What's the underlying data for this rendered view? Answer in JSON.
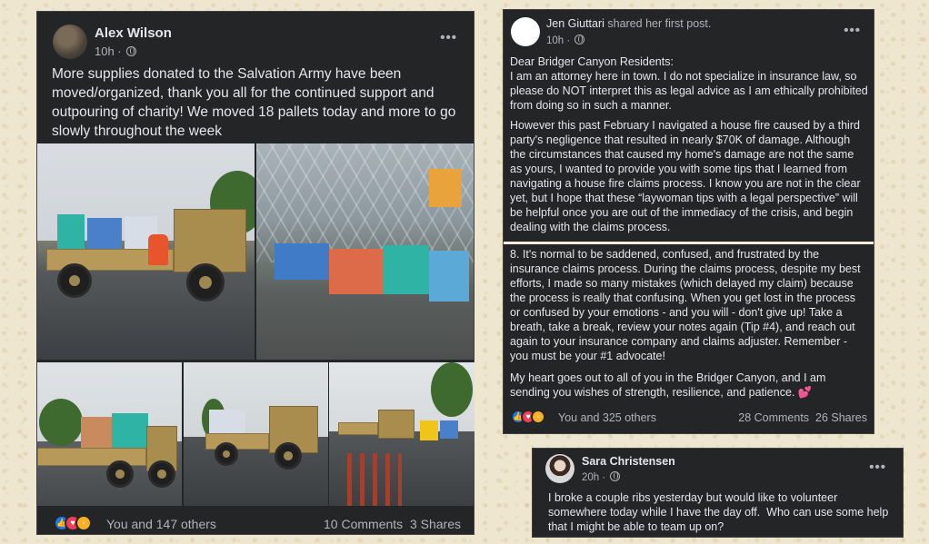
{
  "post1": {
    "author": "Alex Wilson",
    "time": "10h ·",
    "text": "More supplies donated to the Salvation Army have been moved/organized, thank you all for the continued support and outpouring of charity! We moved 18 pallets today and more to go slowly throughout the week",
    "reactions_text": "You and 147 others",
    "comments": "10 Comments",
    "shares": "3 Shares"
  },
  "post2": {
    "author": "Jen Giuttari",
    "action": "shared her first post.",
    "time": "10h ·",
    "paragraphs": [
      "Dear Bridger Canyon Residents:\nI am an attorney here in town. I do not specialize in insurance law, so please do NOT interpret this as legal advice as I am ethically prohibited from doing so in such a manner.",
      "However this past February I navigated a house fire caused by a third party's negligence that resulted in nearly $70K of damage. Although the circumstances that caused my home's damage are not the same as yours, I wanted to provide you with some tips that I learned from navigating a house fire claims process. I know you are not in the clear yet, but I hope that these “laywoman tips with a legal perspective” will be helpful once you are out of the immediacy of the crisis, and begin dealing with the claims process."
    ],
    "paragraphs2": [
      "8. It's normal to be saddened, confused, and frustrated by the insurance claims process. During the claims process, despite my best efforts, I made so many mistakes (which delayed my claim) because the process is really that confusing. When you get lost in the process or confused by your emotions - and you will - don't give up! Take a breath, take a break, review your notes again (Tip #4), and reach out again to your insurance company and claims adjuster. Remember - you must be your #1 advocate!",
      "My heart goes out to all of you in the Bridger Canyon, and I am sending you wishes of strength, resilience, and patience."
    ],
    "heart_emoji": "💕",
    "reactions_text": "You and 325 others",
    "comments": "28 Comments",
    "shares": "26 Shares"
  },
  "post3": {
    "author": "Sara Christensen",
    "time": "20h ·",
    "text": "I broke a couple ribs yesterday but would like to volunteer somewhere today while I have the day off.  Who can use some help that I might be able to team up on?"
  },
  "icons": {
    "more": "more-options-icon",
    "globe": "globe-icon",
    "like": "like-reaction-icon",
    "love": "love-reaction-icon",
    "wow": "wow-reaction-icon",
    "care": "care-reaction-icon"
  },
  "colors": {
    "card_bg": "#242526",
    "text_primary": "#e4e6eb",
    "text_secondary": "#b0b3b8",
    "like_blue": "#1877f2",
    "love_red": "#f33e58",
    "wow_yellow": "#f7b125",
    "page_bg": "#efe6cf"
  }
}
